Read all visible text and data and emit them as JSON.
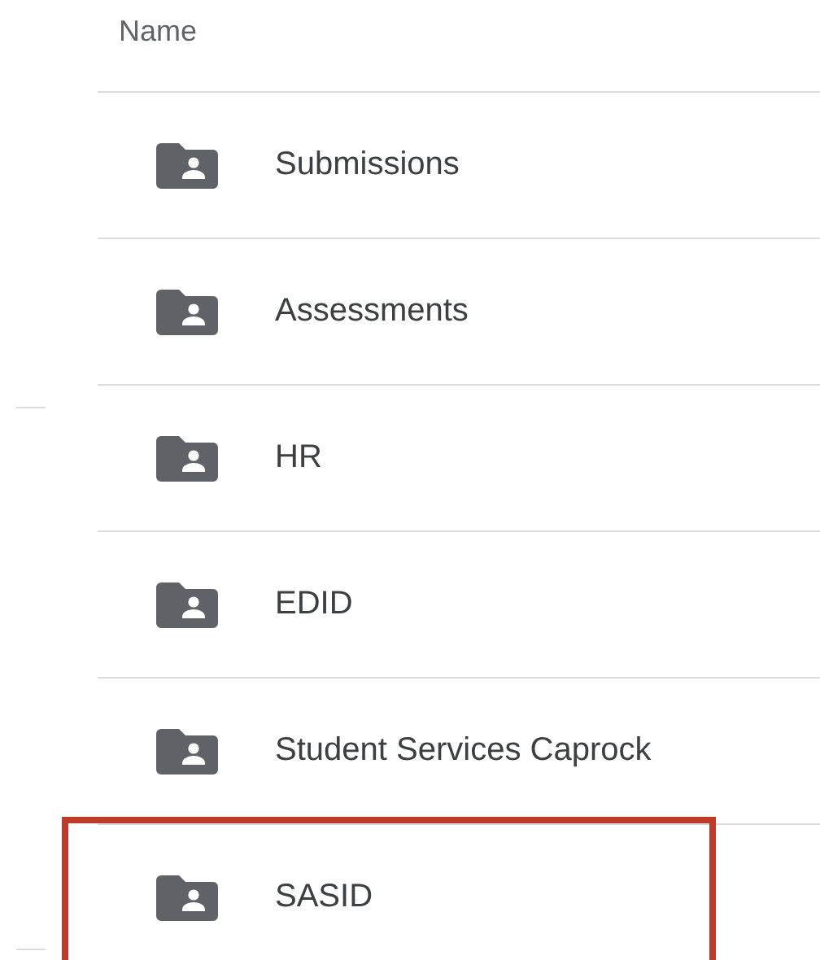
{
  "header": {
    "column_1": "Name"
  },
  "rows": [
    {
      "name": "Submissions",
      "highlighted": false
    },
    {
      "name": "Assessments",
      "highlighted": false
    },
    {
      "name": "HR",
      "highlighted": false
    },
    {
      "name": "EDID",
      "highlighted": false
    },
    {
      "name": "Student Services Caprock",
      "highlighted": false
    },
    {
      "name": "SASID",
      "highlighted": true
    }
  ]
}
